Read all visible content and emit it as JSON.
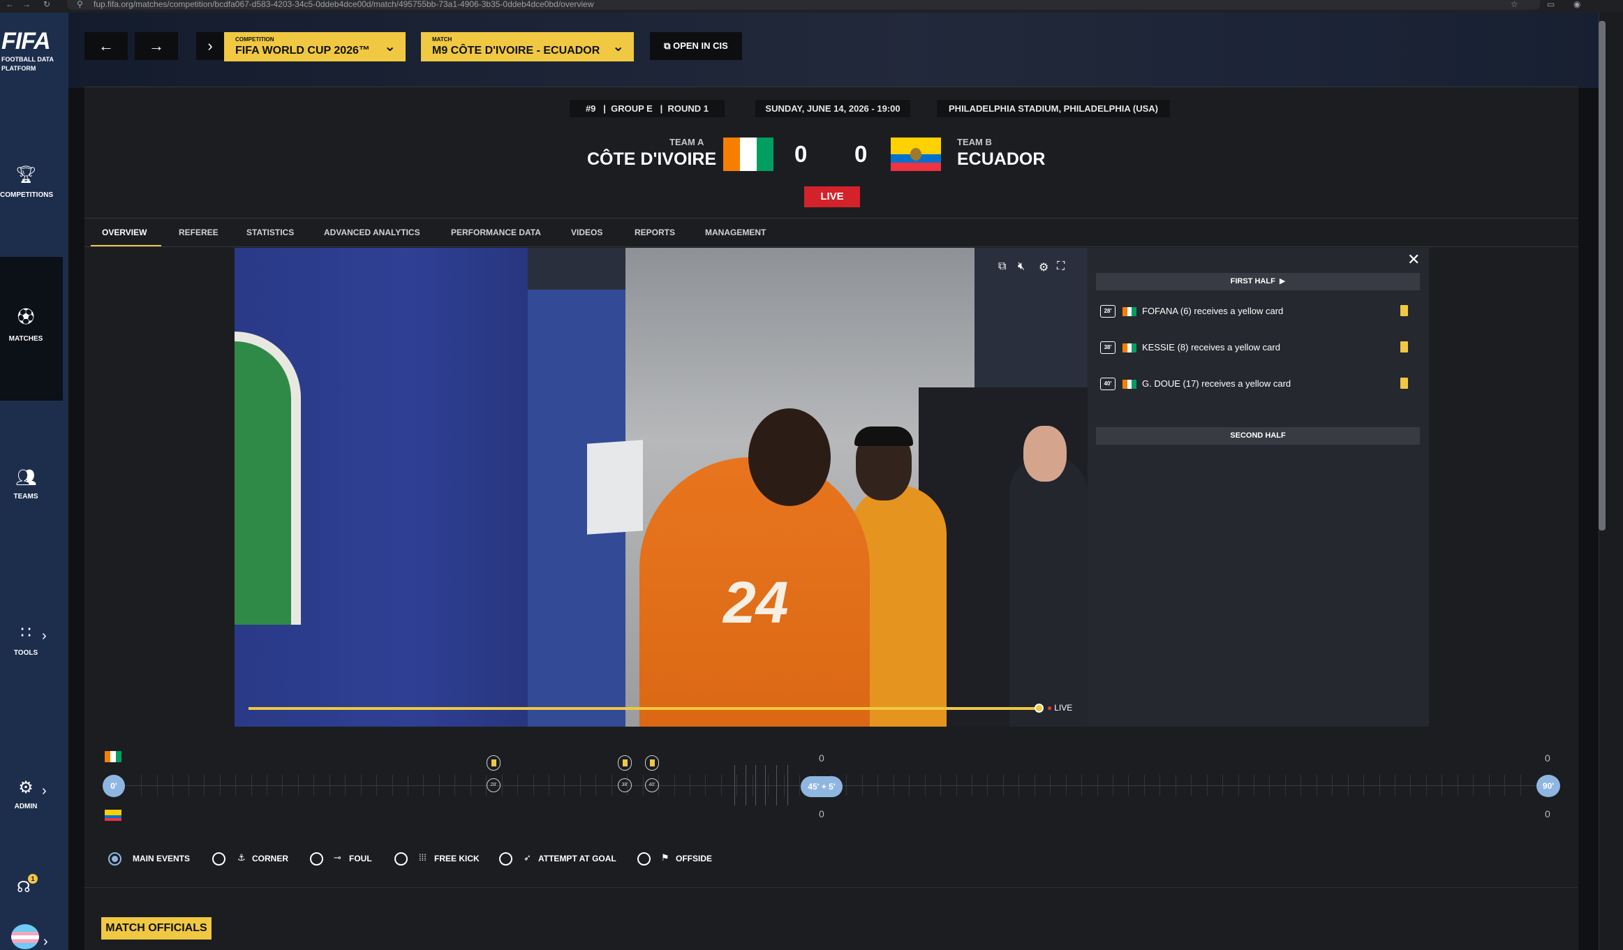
{
  "browser": {
    "url": "fup.fifa.org/matches/competition/bcdfa067-d583-4203-34c5-0ddeb4dce00d/match/495755bb-73a1-4906-3b35-0ddeb4dce0bd/overview"
  },
  "sidebar": {
    "logo": "FIFA",
    "logo_sub1": "FOOTBALL DATA",
    "logo_sub2": "PLATFORM",
    "items": [
      {
        "label": "COMPETITIONS",
        "icon": "trophy-icon"
      },
      {
        "label": "MATCHES",
        "icon": "ball-icon"
      },
      {
        "label": "TEAMS",
        "icon": "team-icon"
      },
      {
        "label": "TOOLS",
        "icon": "tools-icon"
      },
      {
        "label": "ADMIN",
        "icon": "admin-icon"
      }
    ],
    "notification_count": "1"
  },
  "toolbar": {
    "competition_caption": "COMPETITION",
    "competition_value": "FIFA WORLD CUP 2026™",
    "match_caption": "MATCH",
    "match_value": "M9 CÔTE D'IVOIRE - ECUADOR",
    "open_label": "OPEN IN CIS"
  },
  "match": {
    "number": "#9",
    "group": "GROUP E",
    "round": "ROUND 1",
    "datetime": "SUNDAY, JUNE 14, 2026 - 19:00",
    "venue": "PHILADELPHIA STADIUM, PHILADELPHIA (USA)",
    "team_a_caption": "TEAM A",
    "team_a": "CÔTE D'IVOIRE",
    "team_b_caption": "TEAM B",
    "team_b": "ECUADOR",
    "score_a": "0",
    "score_b": "0",
    "status": "LIVE"
  },
  "tabs": [
    {
      "label": "OVERVIEW",
      "active": true
    },
    {
      "label": "REFEREE"
    },
    {
      "label": "STATISTICS"
    },
    {
      "label": "ADVANCED ANALYTICS"
    },
    {
      "label": "PERFORMANCE DATA"
    },
    {
      "label": "VIDEOS"
    },
    {
      "label": "REPORTS"
    },
    {
      "label": "MANAGEMENT"
    }
  ],
  "video": {
    "live_label": "LIVE",
    "jersey_number": "24",
    "progress": 1.0
  },
  "events": {
    "first_half": "FIRST HALF",
    "second_half": "SECOND HALF",
    "items": [
      {
        "minute": "28'",
        "text": "FOFANA (6) receives a yellow card"
      },
      {
        "minute": "38'",
        "text": "KESSIE (8) receives a yellow card"
      },
      {
        "minute": "40'",
        "text": "G. DOUE (17) receives a yellow card"
      }
    ]
  },
  "timeline": {
    "start": "0'",
    "half": "45' + 5'",
    "end": "90'",
    "marks": [
      "28'",
      "38'",
      "40'"
    ],
    "count_ht_a": "0",
    "count_ht_b": "0",
    "count_end_a": "0",
    "count_end_b": "0"
  },
  "filters": [
    {
      "label": "MAIN EVENTS",
      "selected": true
    },
    {
      "label": "CORNER"
    },
    {
      "label": "FOUL"
    },
    {
      "label": "FREE KICK"
    },
    {
      "label": "ATTEMPT AT GOAL"
    },
    {
      "label": "OFFSIDE"
    }
  ],
  "officials_title": "MATCH OFFICIALS",
  "colors": {
    "accent": "#f0c842",
    "live": "#d4222a",
    "sidebar": "#1d2e4d",
    "timeline": "#8fb6e1"
  }
}
